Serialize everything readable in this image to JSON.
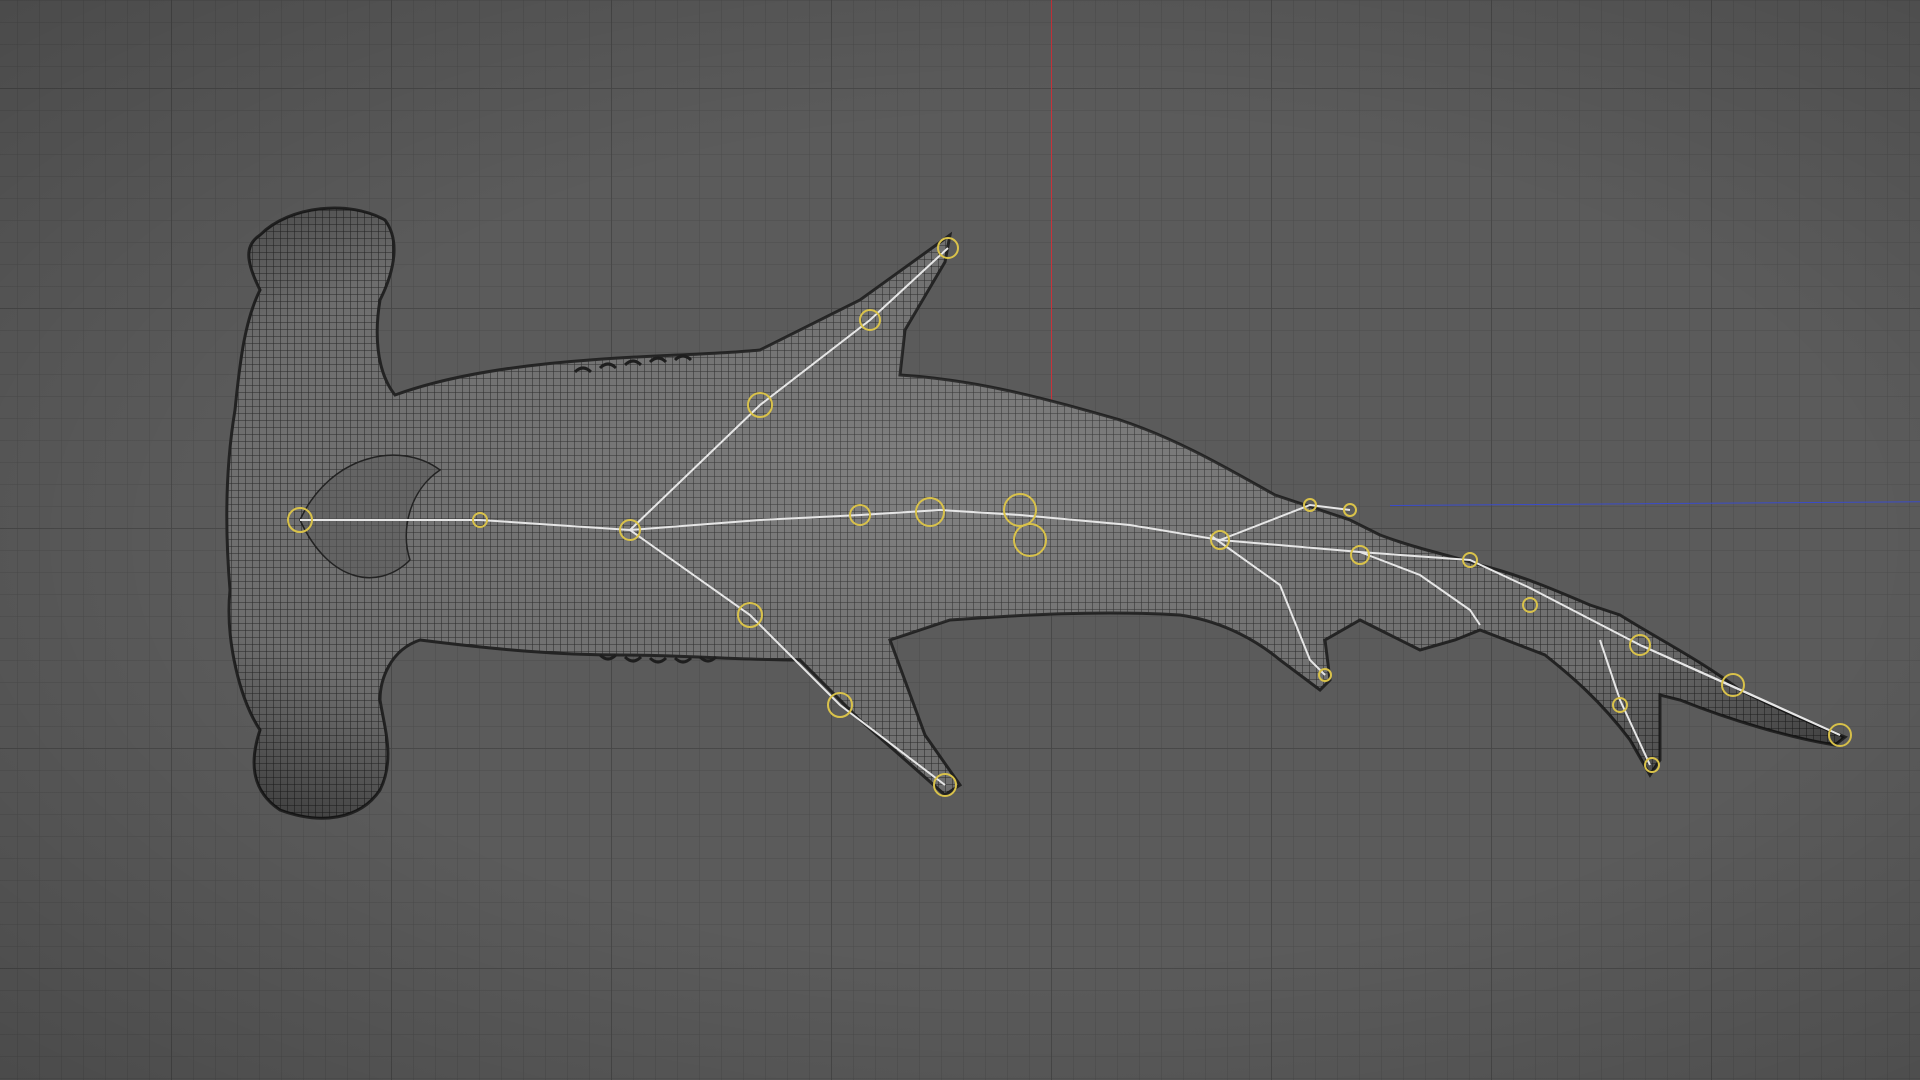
{
  "viewport": {
    "grid_color": "#474747",
    "background_color": "#5b5b5b",
    "axis_y_color": "#c8323a",
    "axis_x_color": "#3b4cc8"
  },
  "model": {
    "subject": "hammerhead-shark-mesh",
    "wire_color": "#2a2a2a",
    "mesh_color": "#6f6f6f",
    "bone_color": "#e8e8e8",
    "joint_color": "#d9c24a"
  }
}
